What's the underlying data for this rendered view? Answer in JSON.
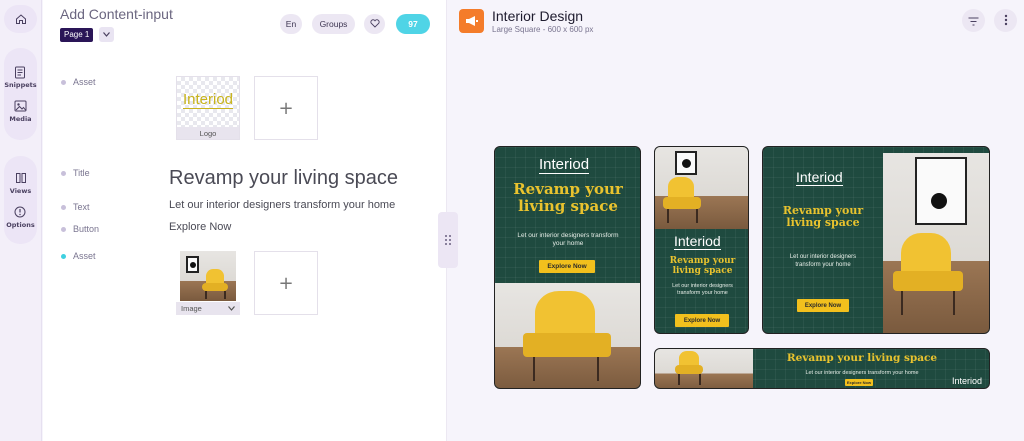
{
  "rail": {
    "items": [
      {
        "icon": "home-icon",
        "label": ""
      },
      {
        "icon": "snippets-icon",
        "label": "Snippets"
      },
      {
        "icon": "media-icon",
        "label": "Media"
      },
      {
        "icon": "views-icon",
        "label": "Views"
      },
      {
        "icon": "options-icon",
        "label": "Options"
      }
    ]
  },
  "editor": {
    "title": "Add Content-input",
    "page_selector": "Page 1",
    "lang": "En",
    "groups": "Groups",
    "count": "97",
    "fields": {
      "asset1": "Asset",
      "title": "Title",
      "text": "Text",
      "button": "Button",
      "asset2": "Asset"
    },
    "logo_caption": "Logo",
    "logo_text": "Interiod",
    "plus": "+",
    "title_value": "Revamp your living space",
    "text_value": "Let our interior designers transform your home",
    "button_value": "Explore Now",
    "image_caption": "Image"
  },
  "preview": {
    "title": "Interior Design",
    "subtitle": "Large Square - 600 x 600 px",
    "ad": {
      "logo": "Interiod",
      "headline_square": "Revamp your living space",
      "headline_banner": "Revamp your living space",
      "body": "Let our interior designers transform your home",
      "cta": "Explore Now"
    }
  },
  "colors": {
    "accent_dark": "#2a1557",
    "count_badge": "#4fd4e6",
    "ad_green": "#1f4a3f",
    "ad_yellow": "#e9c32e",
    "brand_orange": "#f47c2a"
  }
}
